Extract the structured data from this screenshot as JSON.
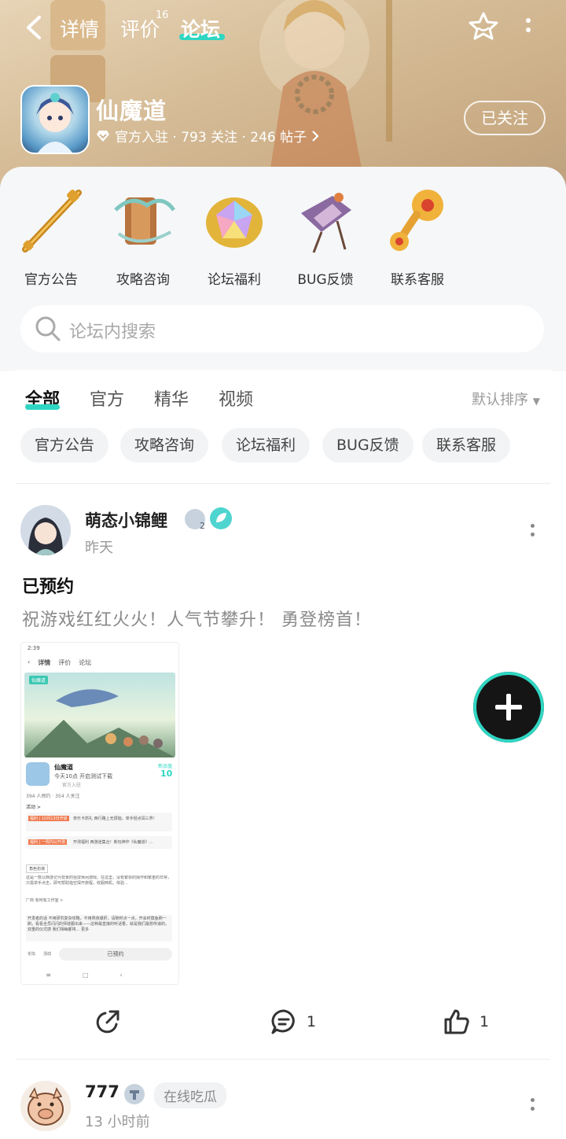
{
  "nav": {
    "tabs": [
      {
        "label": "详情"
      },
      {
        "label": "评价",
        "badge": "16"
      },
      {
        "label": "论坛",
        "active": true
      }
    ]
  },
  "game": {
    "name": "仙魔道",
    "meta": "官方入驻 · 793 关注 · 246 帖子",
    "follow_label": "已关注"
  },
  "categories": [
    {
      "label": "官方公告",
      "icon": "golden-staff-icon"
    },
    {
      "label": "攻略咨询",
      "icon": "scroll-icon"
    },
    {
      "label": "论坛福利",
      "icon": "rainbow-gem-icon"
    },
    {
      "label": "BUG反馈",
      "icon": "kite-icon"
    },
    {
      "label": "联系客服",
      "icon": "golden-ruyi-icon"
    }
  ],
  "search": {
    "placeholder": "论坛内搜索"
  },
  "filter_tabs": [
    {
      "label": "全部",
      "active": true
    },
    {
      "label": "官方"
    },
    {
      "label": "精华"
    },
    {
      "label": "视频"
    }
  ],
  "sort_label": "默认排序",
  "chips": [
    "官方公告",
    "攻略咨询",
    "论坛福利",
    "BUG反馈",
    "联系客服"
  ],
  "posts": [
    {
      "user": "萌态小锦鲤",
      "level_badge": "2",
      "time": "昨天",
      "title": "已预约",
      "body": "祝游戏红红火火！人气节攀升！ 勇登榜首！",
      "screenshot": {
        "status_time": "2:39",
        "tabs": [
          "详情",
          "评价",
          "论坛"
        ],
        "banner_tag": "仙魔道",
        "game_name": "仙魔道",
        "game_line": "今天10点 开启测试下载",
        "game_sub": "官方入驻",
        "score_label": "新品值",
        "score": "10",
        "stats": "394 人预约 · 354 人关注",
        "activity": "活动 >",
        "news1_tag": "福利 | 10月13日开启",
        "news1": "奈乐卡抓礼 西行路上无烦恼，单手轻点闯三界！",
        "news2_tag": "福利 | 一周内公开测",
        "news2": "开测福利 西游迷集合！新玩神作《仙魔道》...",
        "section_tag": "角色扮演",
        "desc": "这是一款以西游记为背景的竖屏休闲游戏。在这里，没有繁杂的操作和繁重的日常，只需单手点击，即可帮助指空探开旅程，收服西机，体验...",
        "dev": "厂商  有何有工作室 >",
        "editor_note": "开发者的话 不用研究复杂攻略，不用熬夜爆肝，请随时点一点，开会时摸鱼刷一刷，看看全员闪闪的师徒跟出来——这种最直接的听话香，就是我们最想传递的。双重的仪式感 我们相每都将... 更多",
        "bottom_left": "论坛",
        "bottom_mid": "活动",
        "button": "已预约"
      },
      "share_label": "",
      "comments": "1",
      "likes": "1"
    },
    {
      "user": "777",
      "tag": "在线吃瓜",
      "time": "13 小时前"
    }
  ],
  "colors": {
    "accent": "#2fd6c2",
    "hero": "#d6bd98"
  }
}
